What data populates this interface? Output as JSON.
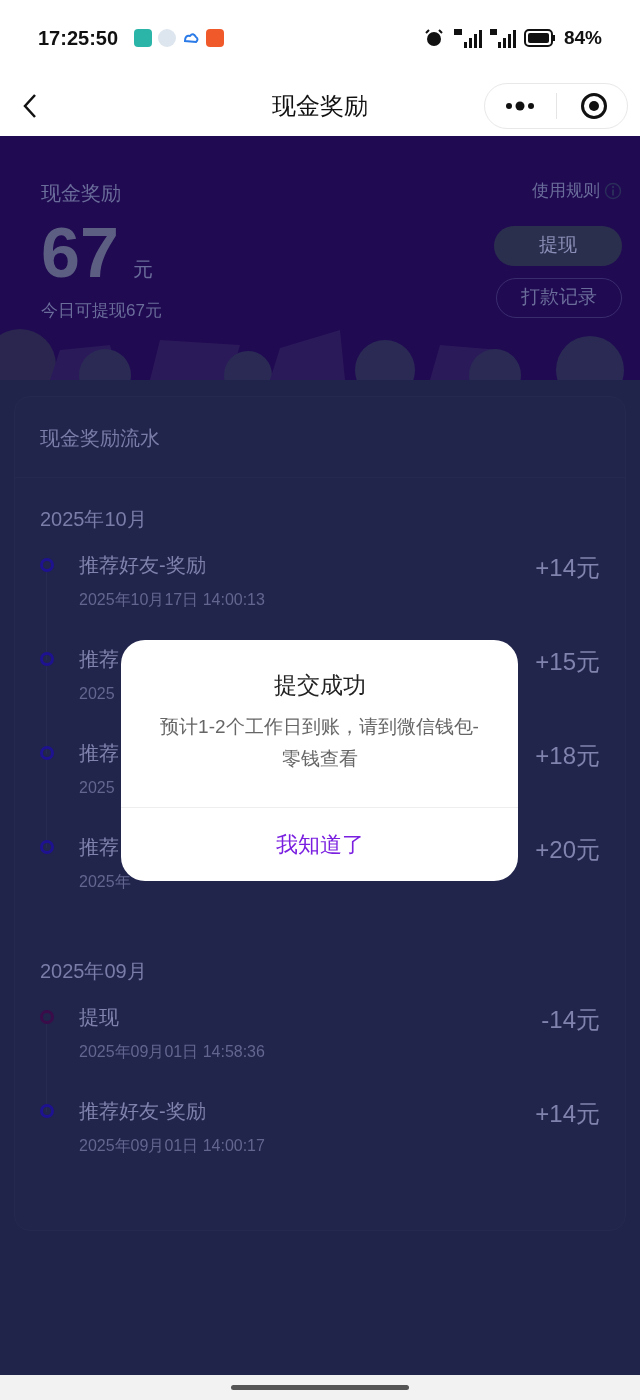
{
  "status_bar": {
    "time": "17:25:50",
    "battery": "84%"
  },
  "nav": {
    "title": "现金奖励"
  },
  "banner": {
    "label": "现金奖励",
    "rules": "使用规则",
    "amount": "67",
    "unit": "元",
    "note": "今日可提现67元",
    "withdraw_button": "提现",
    "records_button": "打款记录"
  },
  "ledger": {
    "title": "现金奖励流水",
    "months": [
      {
        "month": "2025年10月",
        "entries": [
          {
            "title": "推荐好友-奖励",
            "time": "2025年10月17日 14:00:13",
            "amount": "+14元",
            "color": "#1e1290"
          },
          {
            "title": "推荐",
            "time": "2025",
            "amount": "+15元",
            "color": "#1e1290"
          },
          {
            "title": "推荐",
            "time": "2025",
            "amount": "+18元",
            "color": "#1e1290"
          },
          {
            "title": "推荐",
            "time": "2025年",
            "amount": "+20元",
            "color": "#1e1290"
          }
        ]
      },
      {
        "month": "2025年09月",
        "entries": [
          {
            "title": "提现",
            "time": "2025年09月01日 14:58:36",
            "amount": "-14元",
            "color": "#3a0c4a"
          },
          {
            "title": "推荐好友-奖励",
            "time": "2025年09月01日 14:00:17",
            "amount": "+14元",
            "color": "#1e1290"
          }
        ]
      }
    ]
  },
  "dialog": {
    "title": "提交成功",
    "message": "预计1-2个工作日到账，请到微信钱包-零钱查看",
    "button": "我知道了"
  }
}
